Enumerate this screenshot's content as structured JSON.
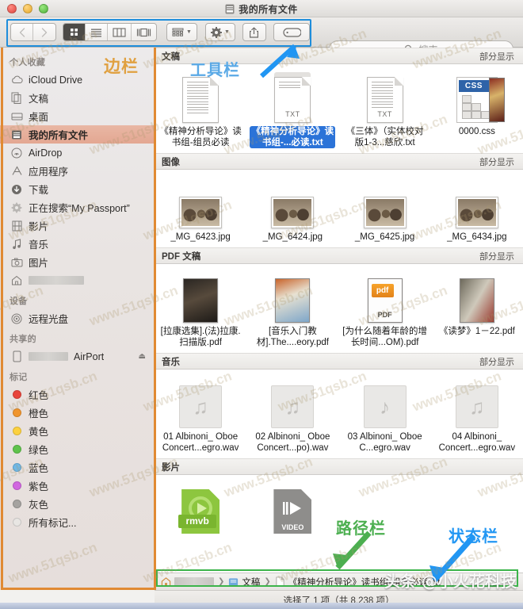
{
  "window": {
    "title": "我的所有文件",
    "traffic_lights": [
      "close-button",
      "minimize-button",
      "maximize-button"
    ]
  },
  "toolbar": {
    "back_label": "‹",
    "forward_label": "›",
    "view_icon": "icon-view",
    "list_view_icon": "list-view",
    "column_view_icon": "column-view",
    "coverflow_view_icon": "coverflow-view",
    "arrange_label": "排列方式",
    "action_label": "操作",
    "share_label": "共享",
    "tag_label": "标记"
  },
  "search": {
    "placeholder": "搜索",
    "value": ""
  },
  "sidebar": {
    "sections": [
      {
        "header": "个人收藏",
        "items": [
          {
            "label": "iCloud Drive",
            "icon": "cloud-icon",
            "selected": false
          },
          {
            "label": "文稿",
            "icon": "documents-icon",
            "selected": false
          },
          {
            "label": "桌面",
            "icon": "desktop-icon",
            "selected": false
          },
          {
            "label": "我的所有文件",
            "icon": "all-files-icon",
            "selected": true
          },
          {
            "label": "AirDrop",
            "icon": "airdrop-icon",
            "selected": false
          },
          {
            "label": "应用程序",
            "icon": "applications-icon",
            "selected": false
          },
          {
            "label": "下载",
            "icon": "downloads-icon",
            "selected": false
          },
          {
            "label": "正在搜索“My Passport”",
            "icon": "search-gear-icon",
            "selected": false
          },
          {
            "label": "影片",
            "icon": "movies-icon",
            "selected": false
          },
          {
            "label": "音乐",
            "icon": "music-icon",
            "selected": false
          },
          {
            "label": "图片",
            "icon": "pictures-icon",
            "selected": false
          },
          {
            "label": "",
            "icon": "home-icon",
            "selected": false,
            "redacted": true
          }
        ]
      },
      {
        "header": "设备",
        "items": [
          {
            "label": "远程光盘",
            "icon": "remote-disc-icon",
            "selected": false
          }
        ]
      },
      {
        "header": "共享的",
        "items": [
          {
            "label": "AirPort",
            "icon": "airport-icon",
            "selected": false,
            "redacted": true,
            "eject": "⏏"
          }
        ]
      },
      {
        "header": "标记",
        "items": [
          {
            "label": "红色",
            "icon": "tag-dot-red",
            "color": "#e8453c"
          },
          {
            "label": "橙色",
            "icon": "tag-dot-orange",
            "color": "#f0952e"
          },
          {
            "label": "黄色",
            "icon": "tag-dot-yellow",
            "color": "#fcd13f"
          },
          {
            "label": "绿色",
            "icon": "tag-dot-green",
            "color": "#5fc34c"
          },
          {
            "label": "蓝色",
            "icon": "tag-dot-blue",
            "color": "#6fb9e8"
          },
          {
            "label": "紫色",
            "icon": "tag-dot-purple",
            "color": "#d167e0"
          },
          {
            "label": "灰色",
            "icon": "tag-dot-gray",
            "color": "#a5a3a0"
          },
          {
            "label": "所有标记...",
            "icon": "tag-dot-all",
            "color": "#e4e2df"
          }
        ]
      }
    ]
  },
  "content": {
    "sections": [
      {
        "title": "文稿",
        "more": "部分显示",
        "items": [
          {
            "name": "《精神分析导论》读书组-组员必读",
            "icon": "txt-document-icon",
            "selected": false,
            "ext": ""
          },
          {
            "name": "《精神分析导论》读书组-...必读.txt",
            "icon": "txt-document-icon",
            "selected": true,
            "ext": "TXT"
          },
          {
            "name": "《三体》（实体校对版1-3...慈欣.txt",
            "icon": "txt-document-icon",
            "selected": false,
            "ext": "TXT"
          },
          {
            "name": "0000.css",
            "icon": "css-file-icon",
            "selected": false,
            "ext": "CSS"
          }
        ]
      },
      {
        "title": "图像",
        "more": "部分显示",
        "items": [
          {
            "name": "_MG_6423.jpg",
            "icon": "photo-icon",
            "selected": false
          },
          {
            "name": "_MG_6424.jpg",
            "icon": "photo-icon",
            "selected": false
          },
          {
            "name": "_MG_6425.jpg",
            "icon": "photo-icon",
            "selected": false
          },
          {
            "name": "_MG_6434.jpg",
            "icon": "photo-icon",
            "selected": false
          }
        ]
      },
      {
        "title": "PDF 文稿",
        "more": "部分显示",
        "items": [
          {
            "name": "[拉康选集].(法)拉康.扫描版.pdf",
            "icon": "pdf-book-icon",
            "selected": false
          },
          {
            "name": "[音乐入门教材].The....eory.pdf",
            "icon": "pdf-book-icon",
            "selected": false
          },
          {
            "name": "[为什么随着年龄的增长时间...OM).pdf",
            "icon": "pdf-generic-icon",
            "selected": false
          },
          {
            "name": "《读梦》1－22.pdf",
            "icon": "pdf-book-icon",
            "selected": false
          }
        ]
      },
      {
        "title": "音乐",
        "more": "部分显示",
        "items": [
          {
            "name": "01 Albinoni_ Oboe Concert...egro.wav",
            "icon": "audio-file-icon",
            "selected": false
          },
          {
            "name": "02 Albinoni_ Oboe Concert...po).wav",
            "icon": "audio-file-icon",
            "selected": false
          },
          {
            "name": "03 Albinoni_ Oboe C...egro.wav",
            "icon": "audio-file-icon",
            "selected": false
          },
          {
            "name": "04 Albinoni_ Concert...egro.wav",
            "icon": "audio-file-icon",
            "selected": false
          }
        ]
      },
      {
        "title": "影片",
        "more": "",
        "items": [
          {
            "name": "",
            "icon": "rmvb-file-icon",
            "selected": false,
            "badge": "rmvb"
          },
          {
            "name": "",
            "icon": "video-file-icon",
            "selected": false,
            "badge": "VIDEO"
          }
        ]
      }
    ]
  },
  "pathbar": {
    "crumbs": [
      {
        "label": "",
        "icon": "home-icon",
        "redacted": true
      },
      {
        "label": "文稿",
        "icon": "folder-blue-icon",
        "redacted": false
      },
      {
        "label": "《精神分析导论》读书组-组员必读.txt",
        "icon": "txt-document-icon",
        "redacted": false
      }
    ],
    "separator": "❯"
  },
  "statusbar": {
    "text": "选择了 1 项（共 8,238 项）"
  },
  "annotations": [
    {
      "id": "sidebar",
      "text": "边栏",
      "color": "#e0a040"
    },
    {
      "id": "toolbar",
      "text": "工具栏",
      "color": "#5aa9e6"
    },
    {
      "id": "path",
      "text": "路径栏",
      "color": "#4caf50"
    },
    {
      "id": "status",
      "text": "状态栏",
      "color": "#2196f3"
    }
  ],
  "watermark": {
    "tile_text": "www.51qsb.cn",
    "footer_text": "头条 @小火花科技"
  }
}
